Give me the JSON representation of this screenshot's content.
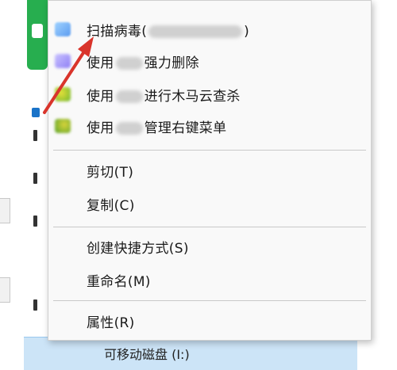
{
  "menu": {
    "items": [
      {
        "label_prefix": "扫描病毒(",
        "label_suffix": ")",
        "icon": "antivirus-scan-icon"
      },
      {
        "label_prefix": "使用",
        "label_suffix": "强力删除",
        "icon": "force-delete-icon"
      },
      {
        "label_prefix": "使用",
        "label_suffix": "进行木马云查杀",
        "icon": "trojan-cloud-scan-icon"
      },
      {
        "label_prefix": "使用",
        "label_suffix": "管理右键菜单",
        "icon": "right-click-manager-icon"
      }
    ],
    "cut": "剪切(T)",
    "copy": "复制(C)",
    "create_shortcut": "创建快捷方式(S)",
    "rename": "重命名(M)",
    "properties": "属性(R)"
  },
  "background": {
    "selected_drive": "可移动磁盘 (I:)"
  },
  "colors": {
    "arrow": "#d9342b",
    "selection": "#cce4f7",
    "green_card": "#27ae4f"
  }
}
